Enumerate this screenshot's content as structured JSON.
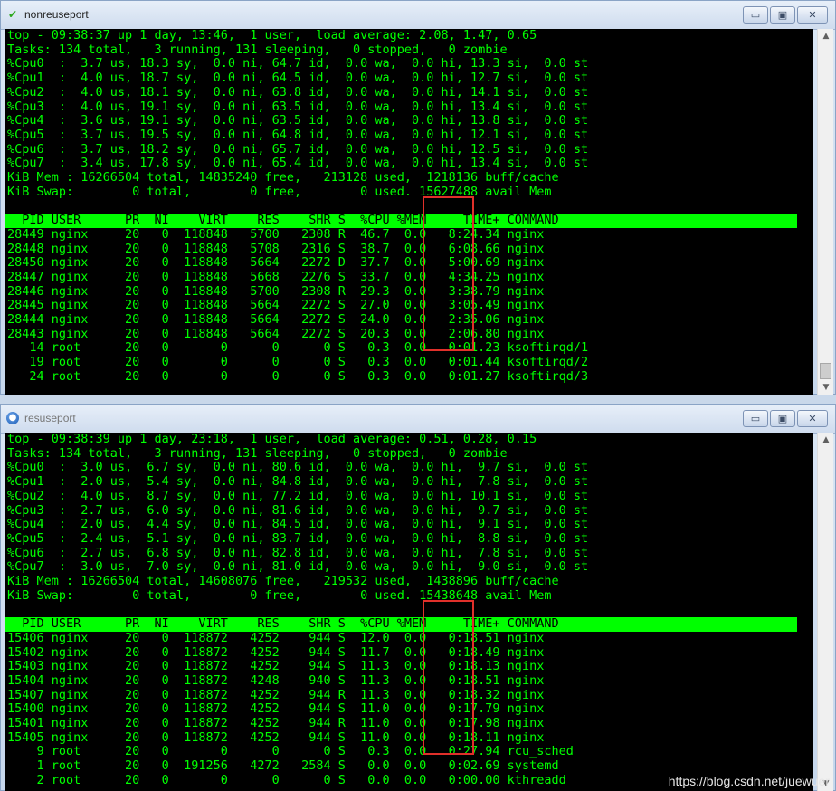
{
  "windows": [
    {
      "title": "nonreuseport",
      "icon": "checkmark-icon",
      "controls": {
        "minimize": "▭",
        "maximize": "▣",
        "close": "✕"
      },
      "summary": [
        "top - 09:38:37 up 1 day, 13:46,  1 user,  load average: 2.08, 1.47, 0.65",
        "Tasks: 134 total,   3 running, 131 sleeping,   0 stopped,   0 zombie",
        "%Cpu0  :  3.7 us, 18.3 sy,  0.0 ni, 64.7 id,  0.0 wa,  0.0 hi, 13.3 si,  0.0 st",
        "%Cpu1  :  4.0 us, 18.7 sy,  0.0 ni, 64.5 id,  0.0 wa,  0.0 hi, 12.7 si,  0.0 st",
        "%Cpu2  :  4.0 us, 18.1 sy,  0.0 ni, 63.8 id,  0.0 wa,  0.0 hi, 14.1 si,  0.0 st",
        "%Cpu3  :  4.0 us, 19.1 sy,  0.0 ni, 63.5 id,  0.0 wa,  0.0 hi, 13.4 si,  0.0 st",
        "%Cpu4  :  3.6 us, 19.1 sy,  0.0 ni, 63.5 id,  0.0 wa,  0.0 hi, 13.8 si,  0.0 st",
        "%Cpu5  :  3.7 us, 19.5 sy,  0.0 ni, 64.8 id,  0.0 wa,  0.0 hi, 12.1 si,  0.0 st",
        "%Cpu6  :  3.7 us, 18.2 sy,  0.0 ni, 65.7 id,  0.0 wa,  0.0 hi, 12.5 si,  0.0 st",
        "%Cpu7  :  3.4 us, 17.8 sy,  0.0 ni, 65.4 id,  0.0 wa,  0.0 hi, 13.4 si,  0.0 st",
        "KiB Mem : 16266504 total, 14835240 free,   213128 used,  1218136 buff/cache",
        "KiB Swap:        0 total,        0 free,        0 used. 15627488 avail Mem"
      ],
      "column_header": "  PID USER      PR  NI    VIRT    RES    SHR S  %CPU %MEM     TIME+ COMMAND",
      "processes": [
        {
          "text": "28449 nginx     20   0  118848   5700   2308 R  46.7  0.0   8:24.34 nginx",
          "bold": true
        },
        {
          "text": "28448 nginx     20   0  118848   5708   2316 S  38.7  0.0   6:08.66 nginx",
          "bold": false
        },
        {
          "text": "28450 nginx     20   0  118848   5664   2272 D  37.7  0.0   5:00.69 nginx",
          "bold": false
        },
        {
          "text": "28447 nginx     20   0  118848   5668   2276 S  33.7  0.0   4:34.25 nginx",
          "bold": false
        },
        {
          "text": "28446 nginx     20   0  118848   5700   2308 R  29.3  0.0   3:38.79 nginx",
          "bold": true
        },
        {
          "text": "28445 nginx     20   0  118848   5664   2272 S  27.0  0.0   3:05.49 nginx",
          "bold": false
        },
        {
          "text": "28444 nginx     20   0  118848   5664   2272 S  24.0  0.0   2:35.06 nginx",
          "bold": false
        },
        {
          "text": "28443 nginx     20   0  118848   5664   2272 S  20.3  0.0   2:06.80 nginx",
          "bold": false
        },
        {
          "text": "   14 root      20   0       0      0      0 S   0.3  0.0   0:01.23 ksoftirqd/1",
          "bold": false
        },
        {
          "text": "   19 root      20   0       0      0      0 S   0.3  0.0   0:01.44 ksoftirqd/2",
          "bold": false
        },
        {
          "text": "   24 root      20   0       0      0      0 S   0.3  0.0   0:01.27 ksoftirqd/3",
          "bold": false
        }
      ]
    },
    {
      "title": "resuseport",
      "icon": "app-globe-icon",
      "controls": {
        "minimize": "▭",
        "maximize": "▣",
        "close": "✕"
      },
      "summary": [
        "top - 09:38:39 up 1 day, 23:18,  1 user,  load average: 0.51, 0.28, 0.15",
        "Tasks: 134 total,   3 running, 131 sleeping,   0 stopped,   0 zombie",
        "%Cpu0  :  3.0 us,  6.7 sy,  0.0 ni, 80.6 id,  0.0 wa,  0.0 hi,  9.7 si,  0.0 st",
        "%Cpu1  :  2.0 us,  5.4 sy,  0.0 ni, 84.8 id,  0.0 wa,  0.0 hi,  7.8 si,  0.0 st",
        "%Cpu2  :  4.0 us,  8.7 sy,  0.0 ni, 77.2 id,  0.0 wa,  0.0 hi, 10.1 si,  0.0 st",
        "%Cpu3  :  2.7 us,  6.0 sy,  0.0 ni, 81.6 id,  0.0 wa,  0.0 hi,  9.7 si,  0.0 st",
        "%Cpu4  :  2.0 us,  4.4 sy,  0.0 ni, 84.5 id,  0.0 wa,  0.0 hi,  9.1 si,  0.0 st",
        "%Cpu5  :  2.4 us,  5.1 sy,  0.0 ni, 83.7 id,  0.0 wa,  0.0 hi,  8.8 si,  0.0 st",
        "%Cpu6  :  2.7 us,  6.8 sy,  0.0 ni, 82.8 id,  0.0 wa,  0.0 hi,  7.8 si,  0.0 st",
        "%Cpu7  :  3.0 us,  7.0 sy,  0.0 ni, 81.0 id,  0.0 wa,  0.0 hi,  9.0 si,  0.0 st",
        "KiB Mem : 16266504 total, 14608076 free,   219532 used,  1438896 buff/cache",
        "KiB Swap:        0 total,        0 free,        0 used. 15438648 avail Mem"
      ],
      "column_header": "  PID USER      PR  NI    VIRT    RES    SHR S  %CPU %MEM     TIME+ COMMAND",
      "processes": [
        {
          "text": "15406 nginx     20   0  118872   4252    944 S  12.0  0.0   0:18.51 nginx",
          "bold": false
        },
        {
          "text": "15402 nginx     20   0  118872   4252    944 S  11.7  0.0   0:18.49 nginx",
          "bold": false
        },
        {
          "text": "15403 nginx     20   0  118872   4252    944 S  11.3  0.0   0:18.13 nginx",
          "bold": false
        },
        {
          "text": "15404 nginx     20   0  118872   4248    940 S  11.3  0.0   0:18.51 nginx",
          "bold": false
        },
        {
          "text": "15407 nginx     20   0  118872   4252    944 R  11.3  0.0   0:18.32 nginx",
          "bold": true
        },
        {
          "text": "15400 nginx     20   0  118872   4252    944 S  11.0  0.0   0:17.79 nginx",
          "bold": false
        },
        {
          "text": "15401 nginx     20   0  118872   4252    944 R  11.0  0.0   0:17.98 nginx",
          "bold": true
        },
        {
          "text": "15405 nginx     20   0  118872   4252    944 S  11.0  0.0   0:18.11 nginx",
          "bold": false
        },
        {
          "text": "    9 root      20   0       0      0      0 S   0.3  0.0   0:27.94 rcu_sched",
          "bold": false
        },
        {
          "text": "    1 root      20   0  191256   4272   2584 S   0.0  0.0   0:02.69 systemd",
          "bold": false
        },
        {
          "text": "    2 root      20   0       0      0      0 S   0.0  0.0   0:00.00 kthreadd",
          "bold": false
        }
      ]
    }
  ],
  "watermark": "https://blog.csdn.net/juewuer",
  "colors": {
    "terminal_bg": "#000000",
    "terminal_fg": "#00ff00",
    "highlight_box": "#e0302a"
  }
}
